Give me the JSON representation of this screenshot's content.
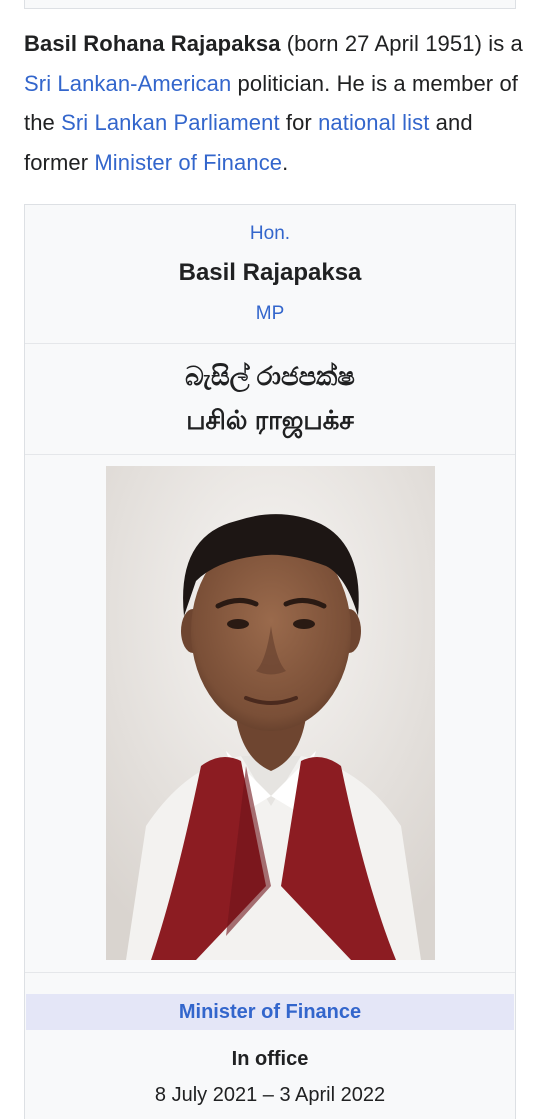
{
  "lead": {
    "subject_name": "Basil Rohana Rajapaksa",
    "text_born": " (born 27 April 1951) is a ",
    "link_nationality": "Sri Lankan-American",
    "text_politician": " politician. He is a member of the ",
    "link_parliament": "Sri Lankan Parliament",
    "text_for": " for ",
    "link_national_list": "national list",
    "text_and_former": " and former ",
    "link_minister": "Minister of Finance",
    "text_end": "."
  },
  "infobox": {
    "honorific": "Hon.",
    "name": "Basil Rajapaksa",
    "postnominal": "MP",
    "native_name_sinhala": "බැසිල් රාජපක්ෂ",
    "native_name_tamil": "பசில் ராஜபக்ச",
    "image_alt": "Portrait of Basil Rajapaksa",
    "office_title": "Minister of Finance",
    "in_office_label": "In office",
    "term": "8 July 2021 – 3 April 2022"
  },
  "colors": {
    "link": "#3366cc",
    "text": "#202122",
    "infobox_bg": "#f8f9fa",
    "office_header_bg": "#e4e6f7"
  }
}
